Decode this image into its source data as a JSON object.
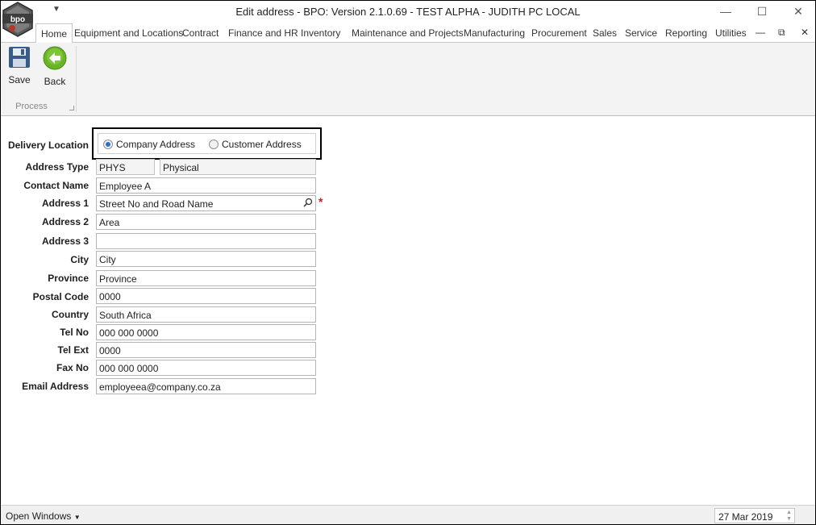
{
  "window": {
    "title": "Edit address - BPO: Version 2.1.0.69 - TEST ALPHA - JUDITH PC LOCAL",
    "minimize": "—",
    "maximize": "☐",
    "close": "✕"
  },
  "ribbon": {
    "tabs": [
      "Home",
      "Equipment and Locations",
      "Contract",
      "Finance and HR",
      "Inventory",
      "Maintenance and Projects",
      "Manufacturing",
      "Procurement",
      "Sales",
      "Service",
      "Reporting",
      "Utilities"
    ],
    "active_tab": "Home",
    "mdi": {
      "minimize": "—",
      "restore": "⧉",
      "close": "✕"
    },
    "buttons": {
      "save": "Save",
      "back": "Back"
    },
    "group_label": "Process",
    "icons": {
      "save": "floppy-disk-icon",
      "back": "back-arrow-icon"
    },
    "colors": {
      "save": "#3a5a8a",
      "back": "#6ab526"
    }
  },
  "form": {
    "delivery_location": {
      "label": "Delivery Location",
      "options": [
        "Company Address",
        "Customer Address"
      ],
      "selected": "Company Address"
    },
    "address_type": {
      "label": "Address Type",
      "code": "PHYS",
      "description": "Physical"
    },
    "contact_name": {
      "label": "Contact Name",
      "value": "Employee A"
    },
    "address1": {
      "label": "Address 1",
      "value": "Street No and Road Name",
      "required_mark": "*"
    },
    "address2": {
      "label": "Address 2",
      "value": "Area"
    },
    "address3": {
      "label": "Address 3",
      "value": ""
    },
    "city": {
      "label": "City",
      "value": "City"
    },
    "province": {
      "label": "Province",
      "value": "Province"
    },
    "postal_code": {
      "label": "Postal Code",
      "value": "0000"
    },
    "country": {
      "label": "Country",
      "value": "South Africa"
    },
    "tel_no": {
      "label": "Tel No",
      "value": "000 000 0000"
    },
    "tel_ext": {
      "label": "Tel Ext",
      "value": "0000"
    },
    "fax_no": {
      "label": "Fax No",
      "value": "000 000 0000"
    },
    "email": {
      "label": "Email Address",
      "value": "employeea@company.co.za"
    }
  },
  "statusbar": {
    "open_windows": "Open Windows",
    "date": "27 Mar 2019"
  }
}
